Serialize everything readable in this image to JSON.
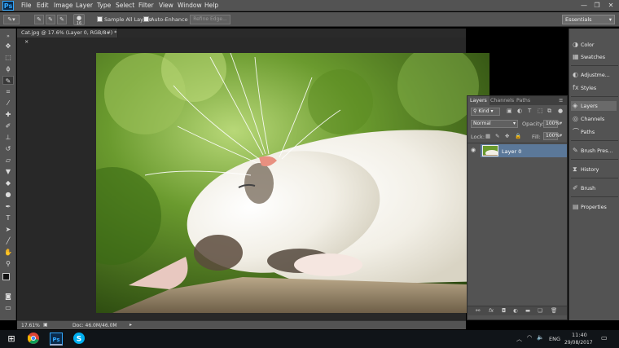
{
  "app": {
    "logo": "Ps"
  },
  "menu": [
    "File",
    "Edit",
    "Image",
    "Layer",
    "Type",
    "Select",
    "Filter",
    "View",
    "Window",
    "Help"
  ],
  "window_controls": {
    "minimize": "—",
    "restore": "❐",
    "close": "✕"
  },
  "options": {
    "brush_size": "16",
    "sample_all_layers": "Sample All Layers",
    "auto_enhance": "Auto-Enhance",
    "refine_edge": "Refine Edge...",
    "workspace": "Essentials"
  },
  "document": {
    "tab_title": "Cat.jpg @ 17.6% (Layer 0, RGB/8#) *"
  },
  "status": {
    "zoom": "17.61%",
    "doc": "Doc: 46.0M/46.0M"
  },
  "layers_panel": {
    "tabs": [
      "Layers",
      "Channels",
      "Paths"
    ],
    "filter_kind": "Kind",
    "blend_mode": "Normal",
    "opacity_label": "Opacity:",
    "opacity_value": "100%",
    "lock_label": "Lock:",
    "fill_label": "Fill:",
    "fill_value": "100%",
    "layers": [
      {
        "name": "Layer 0",
        "visible": true,
        "selected": true
      }
    ]
  },
  "dock": {
    "group1": [
      "Color",
      "Swatches"
    ],
    "group2": [
      "Adjustme...",
      "Styles"
    ],
    "group3": [
      "Layers",
      "Channels",
      "Paths"
    ],
    "group4": [
      "Brush Pres..."
    ],
    "group5": [
      "History"
    ],
    "group6": [
      "Brush"
    ],
    "group7": [
      "Properties"
    ]
  },
  "taskbar": {
    "language": "ENG",
    "time": "11:40",
    "date": "29/08/2017"
  },
  "colors": {
    "ui_gray": "#535353",
    "accent_blue": "#31a8ff",
    "selection_blue": "#5b7899"
  }
}
